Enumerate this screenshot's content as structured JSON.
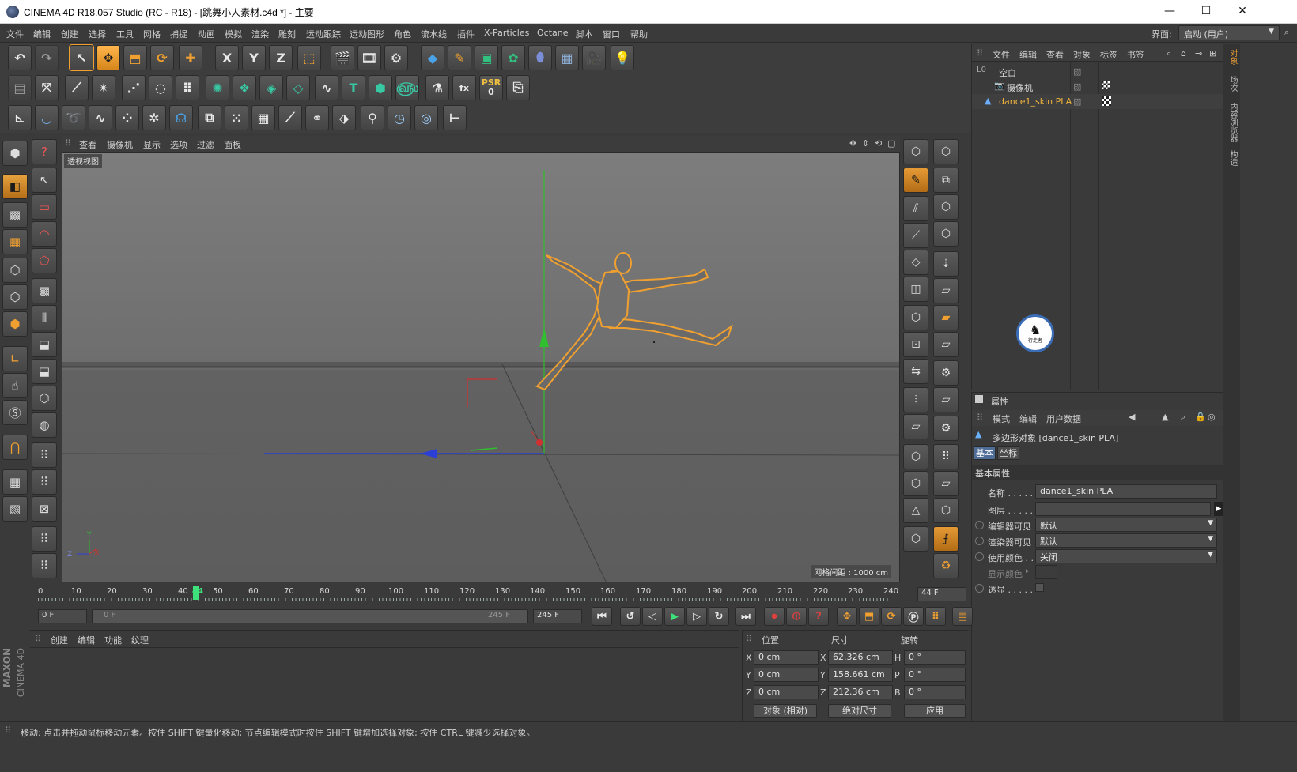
{
  "window": {
    "title": "CINEMA 4D R18.057 Studio (RC - R18) - [跳舞小人素材.c4d *] - 主要",
    "minimize": "—",
    "maximize": "☐",
    "close": "✕"
  },
  "menu": {
    "items": [
      "文件",
      "编辑",
      "创建",
      "选择",
      "工具",
      "网格",
      "捕捉",
      "动画",
      "模拟",
      "渲染",
      "雕刻",
      "运动跟踪",
      "运动图形",
      "角色",
      "流水线",
      "插件",
      "X-Particles",
      "Octane",
      "脚本",
      "窗口",
      "帮助"
    ],
    "layout_label": "界面:",
    "layout_value": "启动 (用户)"
  },
  "toolbar1": {
    "x_label": "X",
    "y_label": "Y",
    "z_label": "Z"
  },
  "toolbar2": {
    "psr_label": "PSR",
    "psr_value": "0",
    "text_tool": "T"
  },
  "viewport": {
    "menu": [
      "查看",
      "摄像机",
      "显示",
      "选项",
      "过滤",
      "面板"
    ],
    "label": "透视视图",
    "grid_info": "网格间距 : 1000 cm",
    "axis_y": "Y",
    "axis_z": "Z",
    "axis_x": "X"
  },
  "objects": {
    "menu": [
      "文件",
      "编辑",
      "查看",
      "对象",
      "标签",
      "书签"
    ],
    "rows": [
      {
        "name": "空白",
        "color": "#d8d8d8"
      },
      {
        "name": "摄像机",
        "color": "#d8d8d8"
      },
      {
        "name": "dance1_skin PLA",
        "color": "#f0b43c"
      }
    ]
  },
  "side_tabs": [
    "对象",
    "场次",
    "内容浏览器",
    "构造"
  ],
  "attributes": {
    "header": "属性",
    "menu": [
      "模式",
      "编辑",
      "用户数据"
    ],
    "object_title": "多边形对象 [dance1_skin PLA]",
    "tabs": [
      "基本",
      "坐标"
    ],
    "section": "基本属性",
    "fields": [
      {
        "label": "名称 . . . . .",
        "value": "dance1_skin PLA"
      },
      {
        "label": "图层 . . . . .",
        "value": ""
      },
      {
        "label": "编辑器可见",
        "value": "默认"
      },
      {
        "label": "渲染器可见",
        "value": "默认"
      },
      {
        "label": "使用颜色 . .",
        "value": "关闭"
      },
      {
        "label": "显示颜色",
        "value": ""
      },
      {
        "label": "透显 . . . . .",
        "value": ""
      }
    ]
  },
  "timeline": {
    "ticks": [
      "0",
      "10",
      "20",
      "30",
      "40",
      "44",
      "50",
      "60",
      "70",
      "80",
      "90",
      "100",
      "110",
      "120",
      "130",
      "140",
      "150",
      "160",
      "170",
      "180",
      "190",
      "200",
      "210",
      "220",
      "230",
      "240"
    ],
    "current_frame": "44 F",
    "start": "0 F",
    "range_start": "0 F",
    "range_end": "245 F",
    "end": "245 F"
  },
  "materials": {
    "menu": [
      "创建",
      "编辑",
      "功能",
      "纹理"
    ]
  },
  "coordinates": {
    "headers": [
      "位置",
      "尺寸",
      "旋转"
    ],
    "rows": [
      {
        "axis": "X",
        "pos": "0 cm",
        "size_axis": "X",
        "size": "62.326 cm",
        "rot_axis": "H",
        "rot": "0 °"
      },
      {
        "axis": "Y",
        "pos": "0 cm",
        "size_axis": "Y",
        "size": "158.661 cm",
        "rot_axis": "P",
        "rot": "0 °"
      },
      {
        "axis": "Z",
        "pos": "0 cm",
        "size_axis": "Z",
        "size": "212.36 cm",
        "rot_axis": "B",
        "rot": "0 °"
      }
    ],
    "mode": "对象 (相对)",
    "size_mode": "绝对尺寸",
    "apply": "应用"
  },
  "status": {
    "text": "移动: 点击并拖动鼠标移动元素。按住 SHIFT 键量化移动; 节点编辑模式时按住 SHIFT 键增加选择对象; 按住 CTRL 键减少选择对象。"
  },
  "logo": {
    "maxon": "MAXON",
    "cinema": "CINEMA 4D",
    "badge": "行走者"
  },
  "colors": {
    "accent": "#e59a35",
    "selected_object": "#f0b43c",
    "axis_y": "#2fbf2f",
    "axis_z": "#2b3fd6",
    "axis_x": "#d23030"
  }
}
